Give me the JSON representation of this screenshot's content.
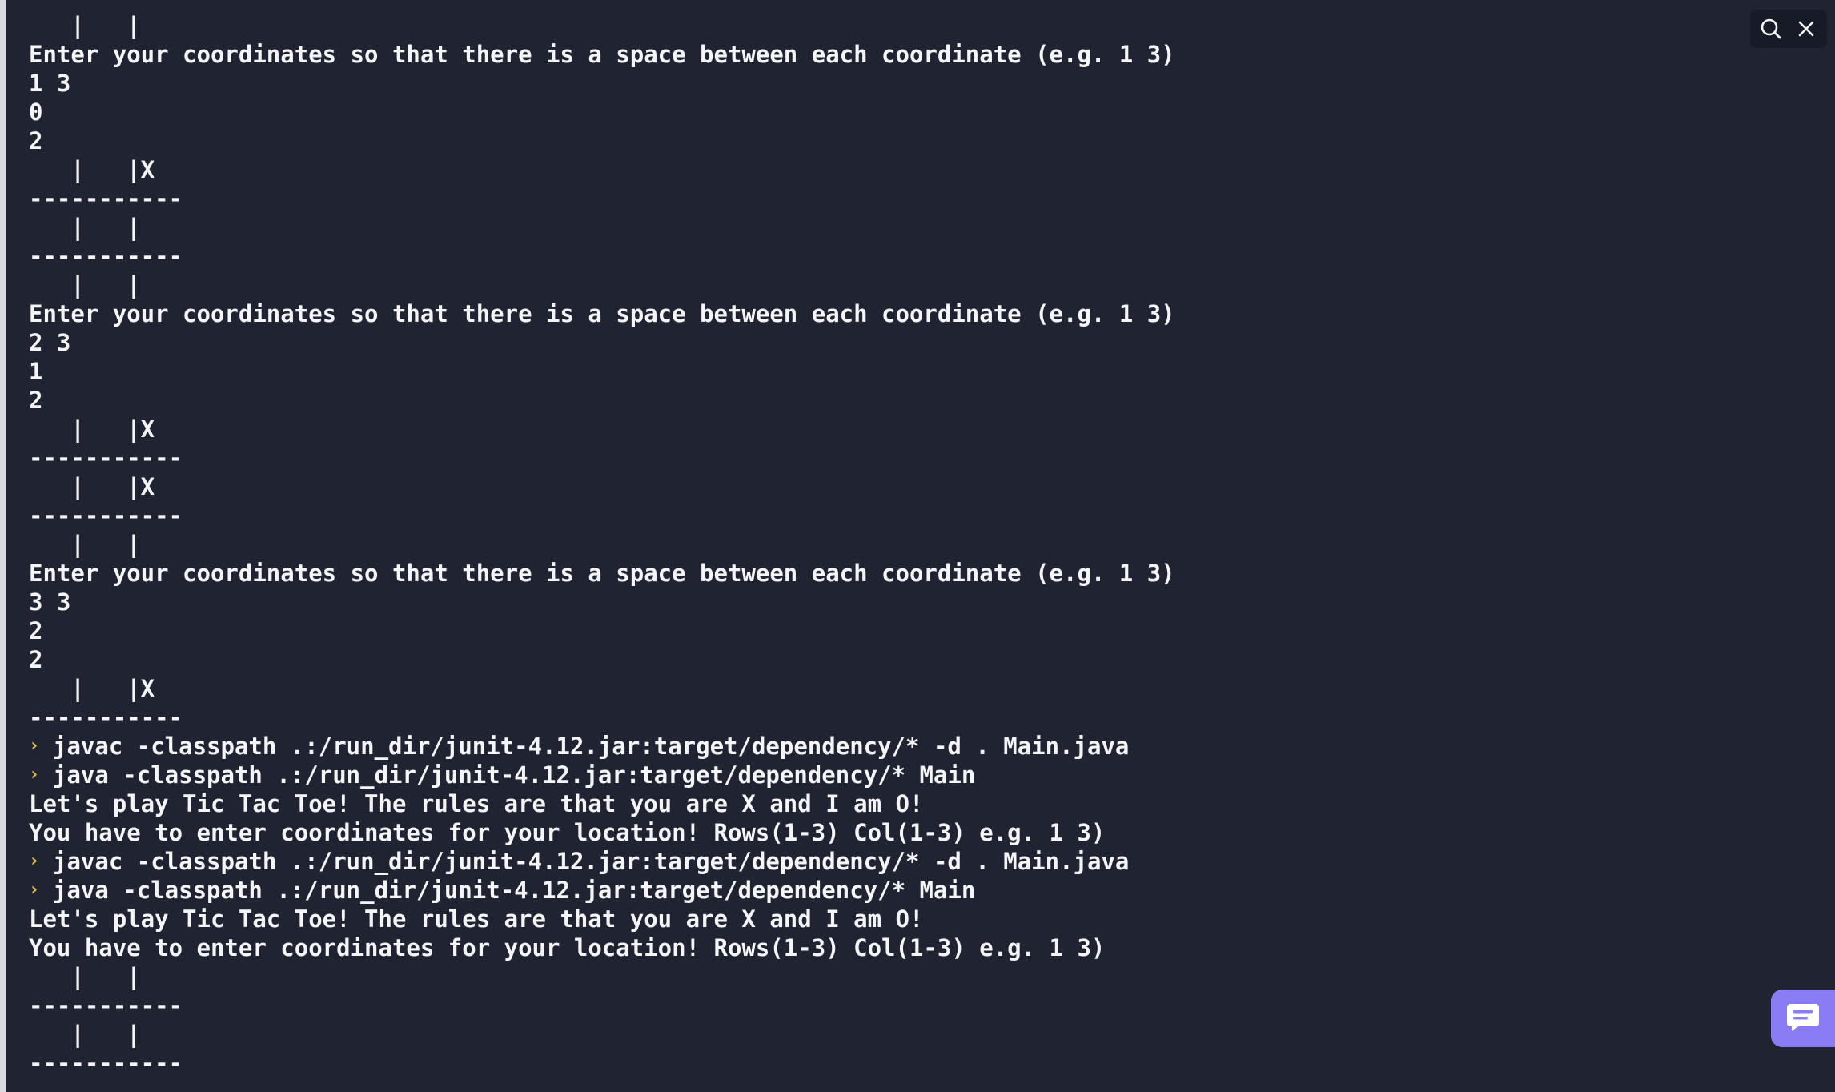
{
  "console": {
    "lines": [
      {
        "prompt": false,
        "text": "   |   |"
      },
      {
        "prompt": false,
        "text": "Enter your coordinates so that there is a space between each coordinate (e.g. 1 3)"
      },
      {
        "prompt": false,
        "text": "1 3"
      },
      {
        "prompt": false,
        "text": "0"
      },
      {
        "prompt": false,
        "text": "2"
      },
      {
        "prompt": false,
        "text": "   |   |X"
      },
      {
        "prompt": false,
        "text": "-----------"
      },
      {
        "prompt": false,
        "text": "   |   |"
      },
      {
        "prompt": false,
        "text": "-----------"
      },
      {
        "prompt": false,
        "text": "   |   |"
      },
      {
        "prompt": false,
        "text": "Enter your coordinates so that there is a space between each coordinate (e.g. 1 3)"
      },
      {
        "prompt": false,
        "text": "2 3"
      },
      {
        "prompt": false,
        "text": "1"
      },
      {
        "prompt": false,
        "text": "2"
      },
      {
        "prompt": false,
        "text": "   |   |X"
      },
      {
        "prompt": false,
        "text": "-----------"
      },
      {
        "prompt": false,
        "text": "   |   |X"
      },
      {
        "prompt": false,
        "text": "-----------"
      },
      {
        "prompt": false,
        "text": "   |   |"
      },
      {
        "prompt": false,
        "text": "Enter your coordinates so that there is a space between each coordinate (e.g. 1 3)"
      },
      {
        "prompt": false,
        "text": "3 3"
      },
      {
        "prompt": false,
        "text": "2"
      },
      {
        "prompt": false,
        "text": "2"
      },
      {
        "prompt": false,
        "text": "   |   |X"
      },
      {
        "prompt": false,
        "text": "-----------"
      },
      {
        "prompt": true,
        "text": "javac -classpath .:/run_dir/junit-4.12.jar:target/dependency/* -d . Main.java"
      },
      {
        "prompt": true,
        "text": "java -classpath .:/run_dir/junit-4.12.jar:target/dependency/* Main"
      },
      {
        "prompt": false,
        "text": "Let's play Tic Tac Toe! The rules are that you are X and I am O!"
      },
      {
        "prompt": false,
        "text": "You have to enter coordinates for your location! Rows(1-3) Col(1-3) e.g. 1 3)"
      },
      {
        "prompt": true,
        "text": "javac -classpath .:/run_dir/junit-4.12.jar:target/dependency/* -d . Main.java"
      },
      {
        "prompt": true,
        "text": "java -classpath .:/run_dir/junit-4.12.jar:target/dependency/* Main"
      },
      {
        "prompt": false,
        "text": "Let's play Tic Tac Toe! The rules are that you are X and I am O!"
      },
      {
        "prompt": false,
        "text": "You have to enter coordinates for your location! Rows(1-3) Col(1-3) e.g. 1 3)"
      },
      {
        "prompt": false,
        "text": "   |   |"
      },
      {
        "prompt": false,
        "text": "-----------"
      },
      {
        "prompt": false,
        "text": "   |   |"
      },
      {
        "prompt": false,
        "text": "-----------"
      }
    ]
  },
  "prompt_glyph": "›",
  "icons": {
    "search": "search-icon",
    "close": "close-icon",
    "chat": "chat-icon"
  },
  "colors": {
    "background": "#1f2332",
    "text": "#f5f5f7",
    "prompt": "#e8c547",
    "chat_button": "#8a7cf5"
  }
}
